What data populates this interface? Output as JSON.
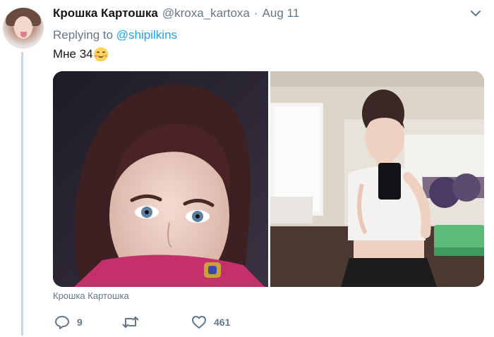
{
  "tweet": {
    "display_name": "Крошка Картошка",
    "handle": "@kroxa_kartoxa",
    "separator": "·",
    "time": "Aug 11",
    "replying_prefix": "Replying to",
    "replying_to": "@shipilkins",
    "text": "Мне 34",
    "emoji": "smiling-face-with-smiling-eyes",
    "media_caption": "Крошка Картошка",
    "reply_count": "9",
    "retweet_count": "",
    "like_count": "461"
  },
  "colors": {
    "text_primary": "#14171a",
    "text_secondary": "#657786",
    "link": "#1da1f2",
    "thread_line": "#cdd5da"
  },
  "icons": {
    "more": "chevron-down-icon",
    "reply": "reply-icon",
    "retweet": "retweet-icon",
    "like": "heart-icon"
  }
}
